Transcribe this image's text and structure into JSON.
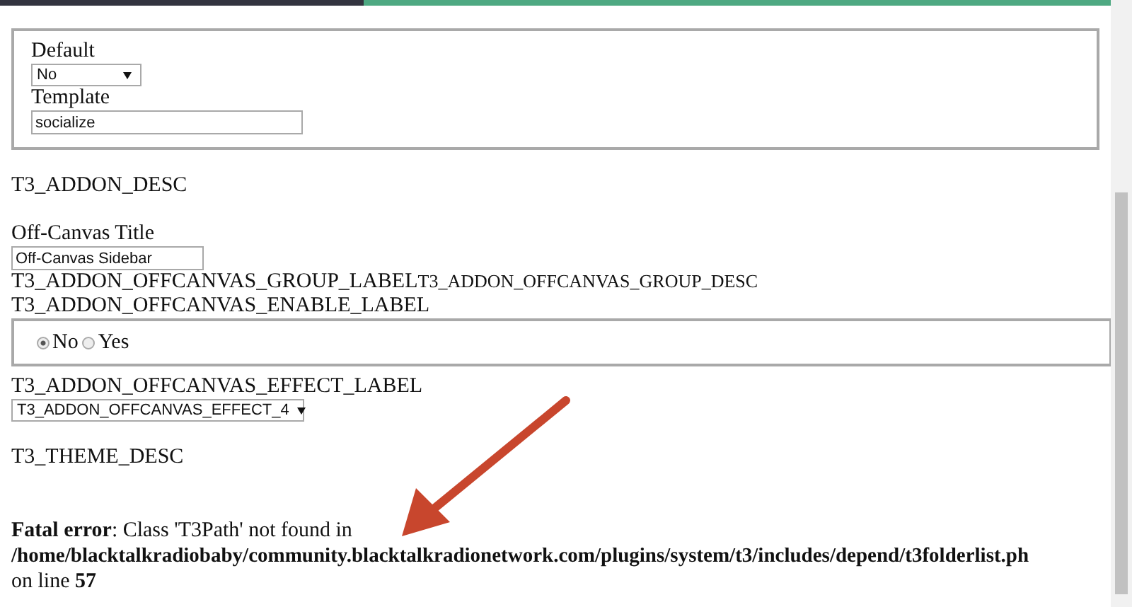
{
  "template_box": {
    "default_label": "Default",
    "default_select": "No",
    "template_label": "Template",
    "template_value": "socialize"
  },
  "addon_desc": "T3_ADDON_DESC",
  "offcanvas_title_label": "Off-Canvas Title",
  "offcanvas_title_value": "Off-Canvas Sidebar",
  "group_label": "T3_ADDON_OFFCANVAS_GROUP_LABEL",
  "group_desc": "T3_ADDON_OFFCANVAS_GROUP_DESC",
  "enable_label": "T3_ADDON_OFFCANVAS_ENABLE_LABEL",
  "enable_options": [
    {
      "label": "No",
      "selected": true
    },
    {
      "label": "Yes",
      "selected": false
    }
  ],
  "effect_label": "T3_ADDON_OFFCANVAS_EFFECT_LABEL",
  "effect_select": "T3_ADDON_OFFCANVAS_EFFECT_4",
  "theme_desc": "T3_THEME_DESC",
  "error": {
    "message": "**Fatal error**: Class 'T3Path' not found in",
    "path": "/home/blacktalkradiobaby/community.blacktalkradionetwork.com/plugins/system/t3/includes/depend/t3folderlist.ph",
    "line": "on line **57**"
  }
}
